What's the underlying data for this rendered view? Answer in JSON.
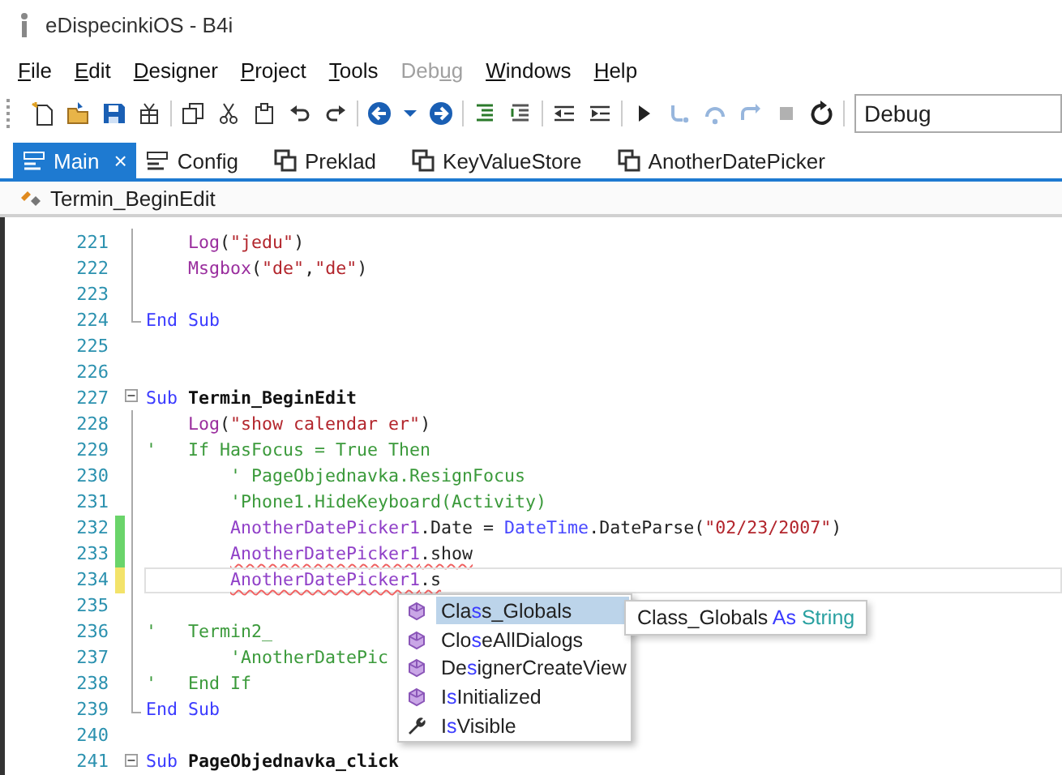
{
  "window": {
    "title": "eDispecinkiOS - B4i"
  },
  "menu": [
    {
      "key": "F",
      "after": "ile",
      "disabled": false
    },
    {
      "key": "E",
      "after": "dit",
      "disabled": false
    },
    {
      "key": "D",
      "after": "esigner",
      "disabled": false
    },
    {
      "key": "P",
      "after": "roject",
      "disabled": false
    },
    {
      "key": "T",
      "after": "ools",
      "disabled": false
    },
    {
      "before": "Deb",
      "key": "u",
      "after": "g",
      "disabled": true
    },
    {
      "key": "W",
      "after": "indows",
      "disabled": false
    },
    {
      "key": "H",
      "after": "elp",
      "disabled": false
    }
  ],
  "toolbar": [
    [
      {
        "kind": "new",
        "disabled": false
      },
      {
        "kind": "open",
        "disabled": false
      },
      {
        "kind": "save",
        "disabled": false
      },
      {
        "kind": "package",
        "disabled": false
      }
    ],
    [
      {
        "kind": "copy",
        "disabled": false
      },
      {
        "kind": "cut",
        "disabled": false
      },
      {
        "kind": "paste",
        "disabled": false
      },
      {
        "kind": "undo",
        "disabled": false
      },
      {
        "kind": "redo",
        "disabled": false
      }
    ],
    [
      {
        "kind": "back",
        "disabled": false
      },
      {
        "kind": "dropdown",
        "disabled": false
      },
      {
        "kind": "forward",
        "disabled": false
      }
    ],
    [
      {
        "kind": "comment",
        "disabled": false
      },
      {
        "kind": "uncomment",
        "disabled": false
      }
    ],
    [
      {
        "kind": "outdent",
        "disabled": false
      },
      {
        "kind": "indent",
        "disabled": false
      }
    ],
    [
      {
        "kind": "run",
        "disabled": false
      },
      {
        "kind": "step-into",
        "disabled": true
      },
      {
        "kind": "step-over",
        "disabled": true
      },
      {
        "kind": "step-out",
        "disabled": true
      },
      {
        "kind": "stop",
        "disabled": true
      },
      {
        "kind": "restart",
        "disabled": false
      }
    ]
  ],
  "build_config": {
    "value": "Debug"
  },
  "tabs": [
    {
      "label": "Main",
      "kind": "module",
      "selected": true,
      "closable": true,
      "close": "×"
    },
    {
      "label": "Config",
      "kind": "module",
      "selected": false,
      "closable": false
    },
    {
      "label": "Preklad",
      "kind": "class",
      "selected": false,
      "closable": false
    },
    {
      "label": "KeyValueStore",
      "kind": "class",
      "selected": false,
      "closable": false
    },
    {
      "label": "AnotherDatePicker",
      "kind": "class",
      "selected": false,
      "closable": false
    }
  ],
  "breadcrumb": {
    "label": "Termin_BeginEdit"
  },
  "code_lines": [
    {
      "number": "221",
      "kind": "in-fold",
      "tokens": [
        {
          "t": "    Log",
          "kind": "fn"
        },
        {
          "t": "("
        },
        {
          "t": "\"jedu\"",
          "kind": "str"
        },
        {
          "t": ")"
        }
      ]
    },
    {
      "number": "222",
      "kind": "in-fold",
      "tokens": [
        {
          "t": "    Msgbox",
          "kind": "fn"
        },
        {
          "t": "("
        },
        {
          "t": "\"de\"",
          "kind": "str"
        },
        {
          "t": ","
        },
        {
          "t": "\"de\"",
          "kind": "str"
        },
        {
          "t": ")"
        }
      ]
    },
    {
      "number": "223",
      "kind": "in-fold"
    },
    {
      "number": "224",
      "kind": "fold-end",
      "tokens": [
        {
          "t": "End Sub",
          "kind": "kw"
        }
      ]
    },
    {
      "number": "225",
      "kind": "plain"
    },
    {
      "number": "226",
      "kind": "plain"
    },
    {
      "number": "227",
      "kind": "fold-start",
      "tokens": [
        {
          "t": "Sub",
          "kind": "kw"
        },
        {
          "t": " Termin_BeginEdit",
          "kind": "bold"
        }
      ]
    },
    {
      "number": "228",
      "kind": "in-fold",
      "tokens": [
        {
          "t": "    Log",
          "kind": "fn"
        },
        {
          "t": "("
        },
        {
          "t": "\"show calendar er\"",
          "kind": "str"
        },
        {
          "t": ")"
        }
      ]
    },
    {
      "number": "229",
      "kind": "in-fold",
      "tokens": [
        {
          "t": "'   If HasFocus = True Then",
          "kind": "comment"
        }
      ]
    },
    {
      "number": "230",
      "kind": "in-fold",
      "tokens": [
        {
          "t": "        ' PageObjednavka.ResignFocus",
          "kind": "comment"
        }
      ]
    },
    {
      "number": "231",
      "kind": "in-fold",
      "tokens": [
        {
          "t": "        'Phone1.HideKeyboard(Activity)",
          "kind": "comment"
        }
      ]
    },
    {
      "number": "232",
      "kind": "in-fold",
      "saved_change": true,
      "tokens": [
        {
          "t": "        AnotherDatePicker1",
          "kind": "ident"
        },
        {
          "t": ".Date = "
        },
        {
          "t": "DateTime",
          "kind": "type"
        },
        {
          "t": ".DateParse("
        },
        {
          "t": "\"02/23/2007\"",
          "kind": "str"
        },
        {
          "t": ")"
        }
      ]
    },
    {
      "number": "233",
      "kind": "in-fold",
      "saved_change": true,
      "tokens": [
        {
          "t": "        AnotherDatePicker1",
          "kind": "ident",
          "error": true
        },
        {
          "t": ".show",
          "error": true
        }
      ]
    },
    {
      "number": "234",
      "kind": "in-fold",
      "unsaved_change": true,
      "current": true,
      "tokens": [
        {
          "t": "        AnotherDatePicker1",
          "kind": "ident",
          "error": true
        },
        {
          "t": ".s",
          "error": true
        }
      ]
    },
    {
      "number": "235",
      "kind": "in-fold"
    },
    {
      "number": "236",
      "kind": "in-fold",
      "tokens": [
        {
          "t": "'   Termin2_",
          "kind": "comment"
        }
      ]
    },
    {
      "number": "237",
      "kind": "in-fold",
      "tokens": [
        {
          "t": "        'AnotherDatePic",
          "kind": "comment"
        }
      ]
    },
    {
      "number": "238",
      "kind": "in-fold",
      "tokens": [
        {
          "t": "'   End If",
          "kind": "comment"
        }
      ]
    },
    {
      "number": "239",
      "kind": "fold-end",
      "tokens": [
        {
          "t": "End Sub",
          "kind": "kw"
        }
      ]
    },
    {
      "number": "240",
      "kind": "plain"
    },
    {
      "number": "241",
      "kind": "fold-start",
      "tokens": [
        {
          "t": "Sub",
          "kind": "kw"
        },
        {
          "t": " PageObjednavka_click",
          "kind": "bold"
        }
      ]
    }
  ],
  "autocomplete": {
    "items": [
      {
        "kind": "method",
        "selected": true,
        "before": "Cla",
        "match": "s",
        "after": "s_Globals"
      },
      {
        "kind": "method",
        "selected": false,
        "before": "Clo",
        "match": "s",
        "after": "eAllDialogs"
      },
      {
        "kind": "method",
        "selected": false,
        "before": "De",
        "match": "s",
        "after": "ignerCreateView"
      },
      {
        "kind": "method",
        "selected": false,
        "before": "I",
        "match": "s",
        "after": "Initialized"
      },
      {
        "kind": "property",
        "selected": false,
        "before": "I",
        "match": "s",
        "after": "Visible"
      }
    ],
    "tooltip": [
      {
        "t": "Class_Globals "
      },
      {
        "t": "As",
        "kind": "kw"
      },
      {
        "t": " String",
        "kind": "typename"
      }
    ]
  }
}
